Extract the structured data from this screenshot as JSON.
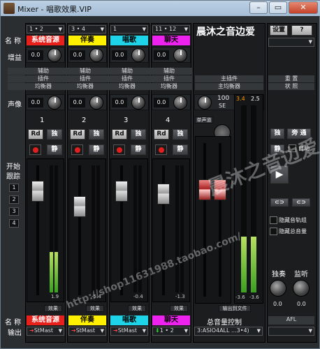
{
  "titlebar": {
    "title": "Mixer - 唱歌效果.VIP",
    "min": "–",
    "max": "▭",
    "close": "✕"
  },
  "left_labels": {
    "name": "名 称",
    "gain": "增益",
    "pan": "声像",
    "start": "开始",
    "follow": "跟踪",
    "bottom_name": "名 称",
    "output": "输出"
  },
  "channels": [
    {
      "sel": "1 • 2",
      "name": "系统音源",
      "name_bg": "#e8201c",
      "name_fg": "#ffffff",
      "gain": "0.0",
      "pan": "0.0",
      "num": "1",
      "rd": "Rd",
      "solo": "独",
      "mute": "静",
      "value": "1.9",
      "fx": "效果",
      "out_name": "系统音源",
      "out": "StMast",
      "fill": 0.32
    },
    {
      "sel": "3 • 4",
      "name": "伴奏",
      "name_bg": "#fff000",
      "name_fg": "#000000",
      "gain": "0.0",
      "pan": "0.0",
      "num": "2",
      "rd": "Rd",
      "solo": "独",
      "mute": "静",
      "value": "-5.4",
      "fx": "效果",
      "out_name": "伴奏",
      "out": "StMast",
      "fill": 0.0
    },
    {
      "sel": "1",
      "name": "唱歌",
      "name_bg": "#1ed4e8",
      "name_fg": "#000000",
      "gain": "0.0",
      "pan": "0.0",
      "num": "3",
      "rd": "Rd",
      "solo": "独",
      "mute": "静",
      "value": "-0.4",
      "fx": "效果",
      "out_name": "唱歌",
      "out": "StMast",
      "fill": 0.0
    },
    {
      "sel": "11 • 12",
      "name": "聊天",
      "name_bg": "#ee22ee",
      "name_fg": "#000000",
      "gain": "0.0",
      "pan": "0.0",
      "num": "4",
      "rd": "Rd",
      "solo": "独",
      "mute": "静",
      "value": "-1.3",
      "fx": "效果",
      "out_name": "聊天",
      "out": "1 • 2",
      "fill": 0.0
    }
  ],
  "channel_rows": {
    "aux": "辅助",
    "insert": "插件",
    "eq": "均衡器"
  },
  "master": {
    "title": "晨沐之音边爱",
    "aux": "主插件",
    "insert": "插件",
    "eq": "主均衡器",
    "pan": "100",
    "se": "SE",
    "mono": "单声道",
    "out_file": "输出到文件",
    "vol_ctrl": "总音量控制",
    "out": "3:ASIO4ALL ...3•4)",
    "peak_l": "3.4",
    "peak_r": "2.5",
    "low_l": "-3.6",
    "low_r": "-3.6",
    "fill": 0.3
  },
  "right_panel": {
    "settings": "设置",
    "help": "?",
    "reset": "重 置",
    "state": "状 照",
    "solo": "独",
    "bypass": "旁 通",
    "mute": "静",
    "auto": "自动",
    "hide_tracks": "隐藏音轨组",
    "hide_vol": "隐藏总音量",
    "solo_label": "独奏",
    "monitor_label": "监听",
    "solo_val": "0.0",
    "mon_val": "0.0",
    "afl": "AFL"
  },
  "track_nums": [
    "1",
    "2",
    "3",
    "4"
  ],
  "watermark": {
    "line1": "晨沐之音边爱",
    "line2": "http://shop11631988.taobao.com/"
  }
}
